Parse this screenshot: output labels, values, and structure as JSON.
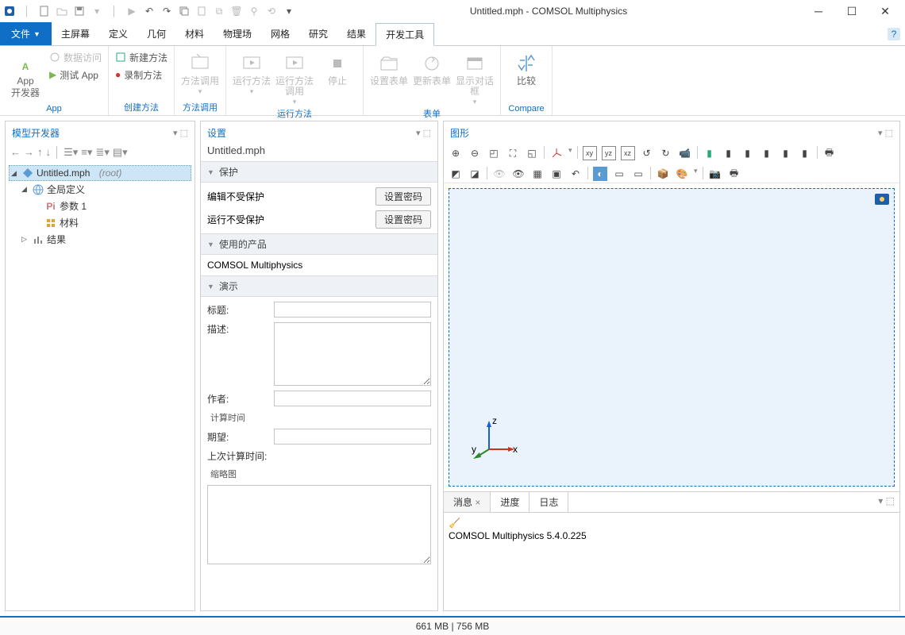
{
  "title": "Untitled.mph - COMSOL Multiphysics",
  "menu": {
    "file": "文件",
    "items": [
      "主屏幕",
      "定义",
      "几何",
      "材料",
      "物理场",
      "网格",
      "研究",
      "结果",
      "开发工具"
    ],
    "active": 8
  },
  "ribbon": {
    "groups": [
      {
        "label": "App",
        "big": [
          {
            "l1": "App",
            "l2": "开发器"
          }
        ],
        "small": [
          "数据访问",
          "测试 App"
        ]
      },
      {
        "label": "创建方法",
        "small": [
          "新建方法",
          "录制方法"
        ]
      },
      {
        "label": "方法调用",
        "big": [
          {
            "l1": "方法调用"
          }
        ]
      },
      {
        "label": "运行方法",
        "big": [
          {
            "l1": "运行方法"
          },
          {
            "l1": "运行方法调用"
          },
          {
            "l1": "停止"
          }
        ]
      },
      {
        "label": "表单",
        "big": [
          {
            "l1": "设置表单"
          },
          {
            "l1": "更新表单"
          },
          {
            "l1": "显示对话框"
          }
        ]
      },
      {
        "label": "Compare",
        "big": [
          {
            "l1": "比较"
          }
        ]
      }
    ]
  },
  "model_panel": {
    "title": "模型开发器"
  },
  "tree": {
    "root": "Untitled.mph",
    "root_suffix": "(root)",
    "global": "全局定义",
    "params": "参数 1",
    "materials": "材料",
    "results": "结果"
  },
  "settings": {
    "title": "设置",
    "subtitle": "Untitled.mph",
    "s_protect": "保护",
    "edit_unprotected": "编辑不受保护",
    "run_unprotected": "运行不受保护",
    "setpw": "设置密码",
    "s_products": "使用的产品",
    "product": "COMSOL Multiphysics",
    "s_demo": "演示",
    "f_title": "标题:",
    "f_desc": "描述:",
    "f_author": "作者:",
    "fs_time": "计算时间",
    "f_expect": "期望:",
    "f_last": "上次计算时间:",
    "fs_thumb": "缩略图",
    "vals": {
      "title": "",
      "desc": "",
      "author": "",
      "expect": "",
      "last": ""
    }
  },
  "graphics": {
    "title": "图形",
    "axes": {
      "x": "x",
      "y": "y",
      "z": "z"
    }
  },
  "messages": {
    "tabs": [
      "消息",
      "进度",
      "日志"
    ],
    "text": "COMSOL Multiphysics 5.4.0.225"
  },
  "status": "661 MB | 756 MB"
}
